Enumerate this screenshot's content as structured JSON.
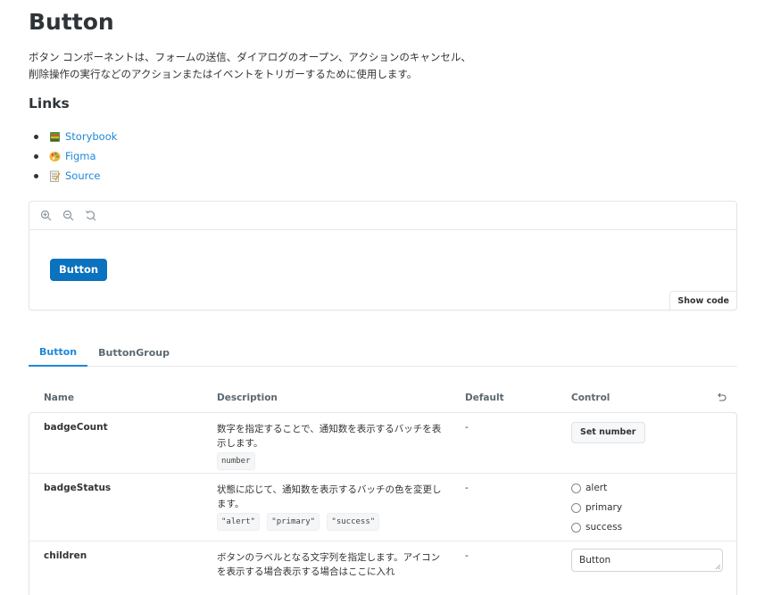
{
  "page": {
    "title": "Button",
    "description_line1": "ボタン コンポーネントは、フォームの送信、ダイアログのオープン、アクションのキャンセル、",
    "description_line2": "削除操作の実行などのアクションまたはイベントをトリガーするために使用します。"
  },
  "links": {
    "heading": "Links",
    "items": [
      {
        "label": "Storybook",
        "icon": "book-emoji-icon"
      },
      {
        "label": "Figma",
        "icon": "palette-emoji-icon"
      },
      {
        "label": "Source",
        "icon": "memo-emoji-icon"
      }
    ]
  },
  "preview": {
    "toolbar_icons": [
      "zoom-in-icon",
      "zoom-out-icon",
      "reset-zoom-icon"
    ],
    "demo_button_label": "Button",
    "show_code_label": "Show code"
  },
  "tabs": [
    {
      "label": "Button",
      "active": true
    },
    {
      "label": "ButtonGroup",
      "active": false
    }
  ],
  "args_table": {
    "headers": {
      "name": "Name",
      "description": "Description",
      "default": "Default",
      "control": "Control"
    },
    "rows": [
      {
        "name": "badgeCount",
        "description": "数字を指定することで、通知数を表示するバッチを表示します。",
        "types": [
          "number"
        ],
        "default": "-",
        "control_label": "Set number"
      },
      {
        "name": "badgeStatus",
        "description": "状態に応じて、通知数を表示するバッチの色を変更します。",
        "types": [
          "\"alert\"",
          "\"primary\"",
          "\"success\""
        ],
        "default": "-",
        "options": [
          "alert",
          "primary",
          "success"
        ]
      },
      {
        "name": "children",
        "description": "ボタンのラベルとなる文字列を指定します。アイコンを表示する場合表示する場合はここに入れ",
        "default": "-",
        "control_value": "Button"
      }
    ]
  },
  "colors": {
    "accent": "#1e88d8",
    "primary_button": "#0a72bf"
  }
}
